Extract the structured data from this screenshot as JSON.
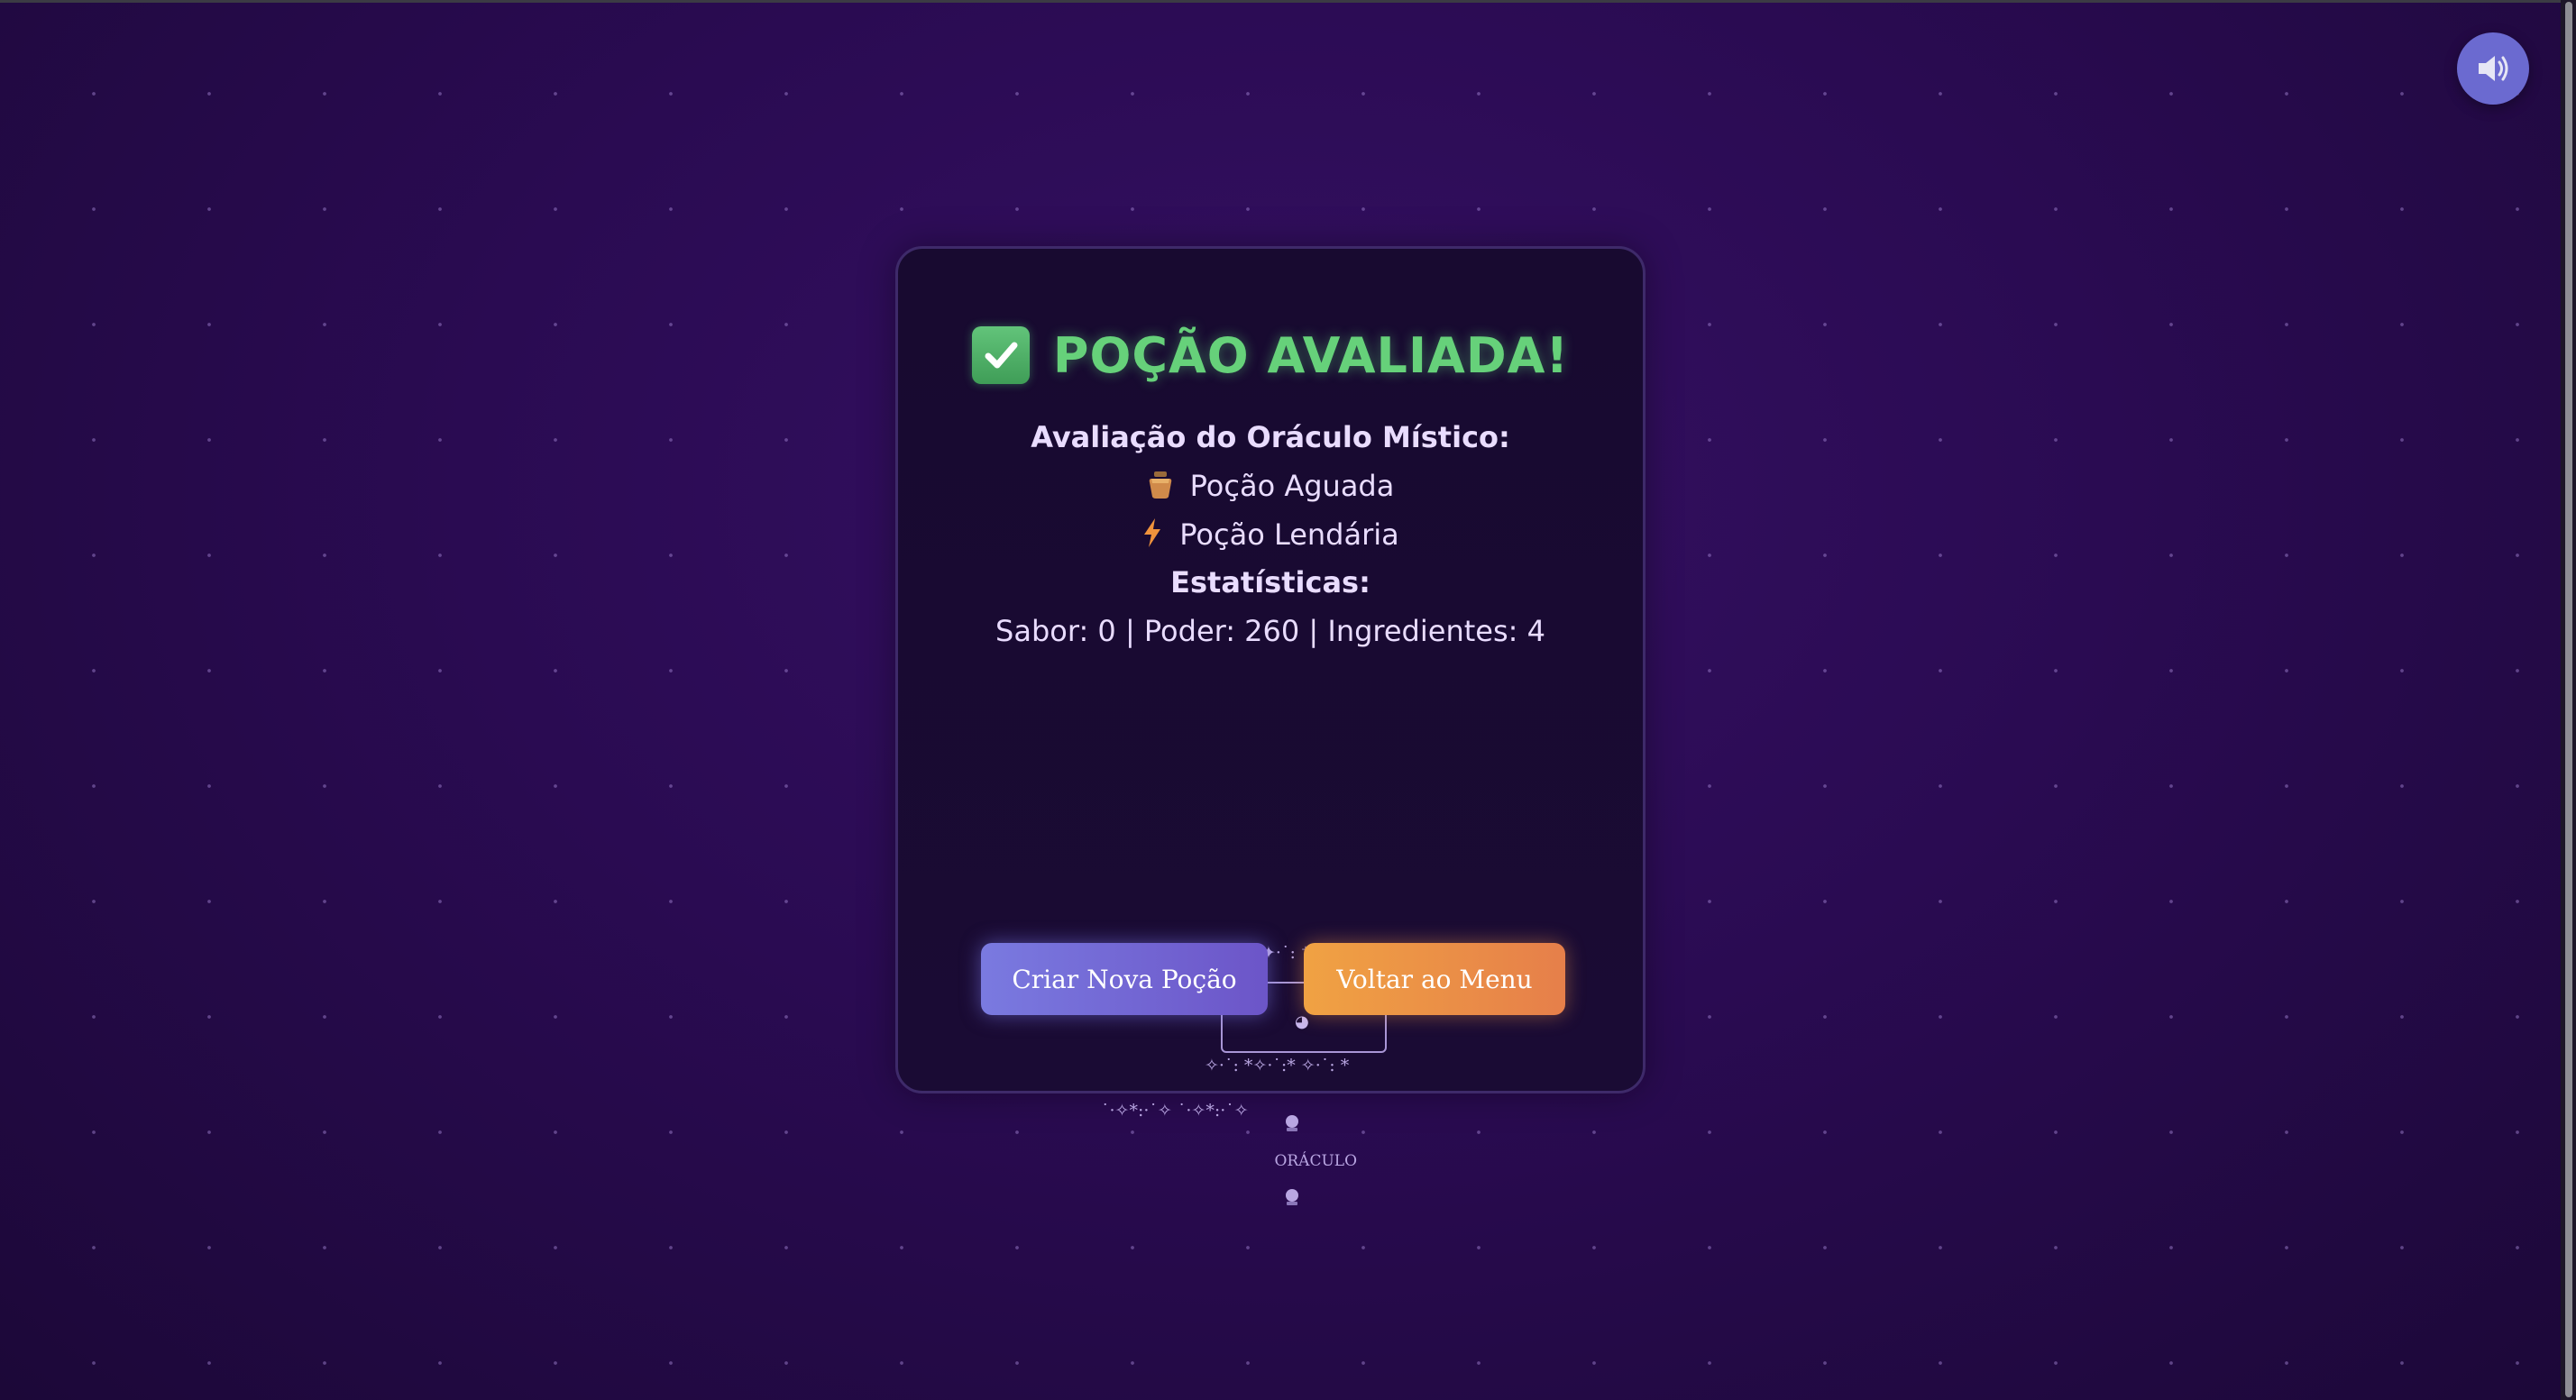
{
  "title": "POÇÃO AVALIADA!",
  "evaluation": {
    "heading": "Avaliação do Oráculo Místico:",
    "results": [
      {
        "icon": "potion-jar-icon",
        "label": "Poção Aguada"
      },
      {
        "icon": "lightning-bolt-icon",
        "label": "Poção Lendária"
      }
    ]
  },
  "stats": {
    "heading": "Estatísticas:",
    "line": "Sabor: 0 | Poder: 260 | Ingredientes: 4"
  },
  "oracle_art": {
    "top_sparkles": "✦·˙: ⁺✦·˙:*",
    "eyes_left": "◉",
    "eyes_right": "◉",
    "mouth": "◕",
    "bottom_sparkles": "✧·˙: *✧·˙:* ✧·˙: *",
    "label": "ORÁCULO",
    "label_icon": "crystal-ball-icon",
    "trailing_sparkles": "˙·✧*:·˙✧ ˙·✧*:·˙✧"
  },
  "buttons": {
    "new_potion": "Criar Nova Poção",
    "back_to_menu": "Voltar ao Menu"
  },
  "colors": {
    "title_green": "#66d17a",
    "new_button": "#7a7ae0",
    "menu_button": "#f0a243",
    "sound_button": "#6b6ad0"
  },
  "sound": {
    "icon": "speaker-icon"
  }
}
